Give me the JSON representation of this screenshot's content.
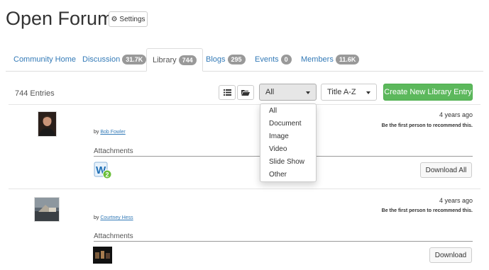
{
  "header": {
    "title": "Open Forum",
    "settings_label": "Settings"
  },
  "tabs": [
    {
      "label": "Community Home",
      "badge": ""
    },
    {
      "label": "Discussion",
      "badge": "31.7K"
    },
    {
      "label": "Library",
      "badge": "744"
    },
    {
      "label": "Blogs",
      "badge": "295"
    },
    {
      "label": "Events",
      "badge": "0"
    },
    {
      "label": "Members",
      "badge": "11.6K"
    }
  ],
  "toolbar": {
    "entries": "744 Entries",
    "filter_value": "All",
    "sort_value": "Title A-Z",
    "create_label": "Create New Library Entry"
  },
  "filter_options": [
    "All",
    "Document",
    "Image",
    "Video",
    "Slide Show",
    "Other"
  ],
  "entries": [
    {
      "time": "4 years ago",
      "recommend": "Be the first person to recommend this.",
      "by": "by",
      "author": "Bob Fowler",
      "attachments_label": "Attachments",
      "button": "Download All"
    },
    {
      "time": "4 years ago",
      "recommend": "Be the first person to recommend this.",
      "by": "by",
      "author": "Courtney Hess",
      "attachments_label": "Attachments",
      "button": "Download"
    }
  ],
  "colors": {
    "link": "#337ab7",
    "create": "#5cb85c",
    "badge": "#999999"
  }
}
